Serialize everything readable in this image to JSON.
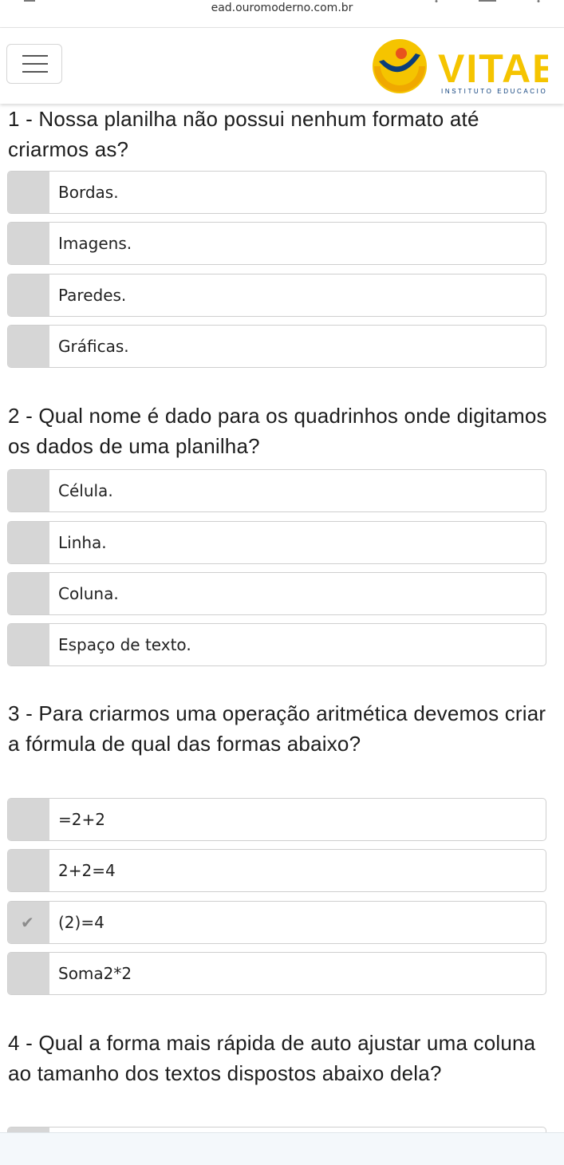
{
  "browser": {
    "url": "ead.ouromoderno.com.br"
  },
  "header": {
    "menu_icon": "hamburger-menu-icon",
    "logo_text": "VITAE",
    "logo_subtext": "INSTITUTO EDUCACIONAL"
  },
  "questions": [
    {
      "text": "1 - Nossa planilha não possui nenhum formato até criarmos as?",
      "options": [
        "Bordas.",
        "Imagens.",
        "Paredes.",
        "Gráficas."
      ]
    },
    {
      "text": "2 - Qual nome é dado para os quadrinhos onde digitamos os dados de uma planilha?",
      "options": [
        "Célula.",
        "Linha.",
        "Coluna.",
        "Espaço de texto."
      ]
    },
    {
      "text": "3 - Para criarmos uma operação aritmética devemos criar a fórmula de qual das formas abaixo?",
      "options": [
        "=2+2",
        "2+2=4",
        "(2)=4",
        "Soma2*2"
      ],
      "checked_option": "(2)=4"
    },
    {
      "text": "4 - Qual a forma mais rápida de auto ajustar uma coluna ao tamanho dos textos dispostos abaixo dela?",
      "options": []
    }
  ],
  "colors": {
    "logo_blue": "#0a3d7a",
    "logo_yellow": "#f5c400",
    "checkbox_gray": "#d6d6d6"
  }
}
